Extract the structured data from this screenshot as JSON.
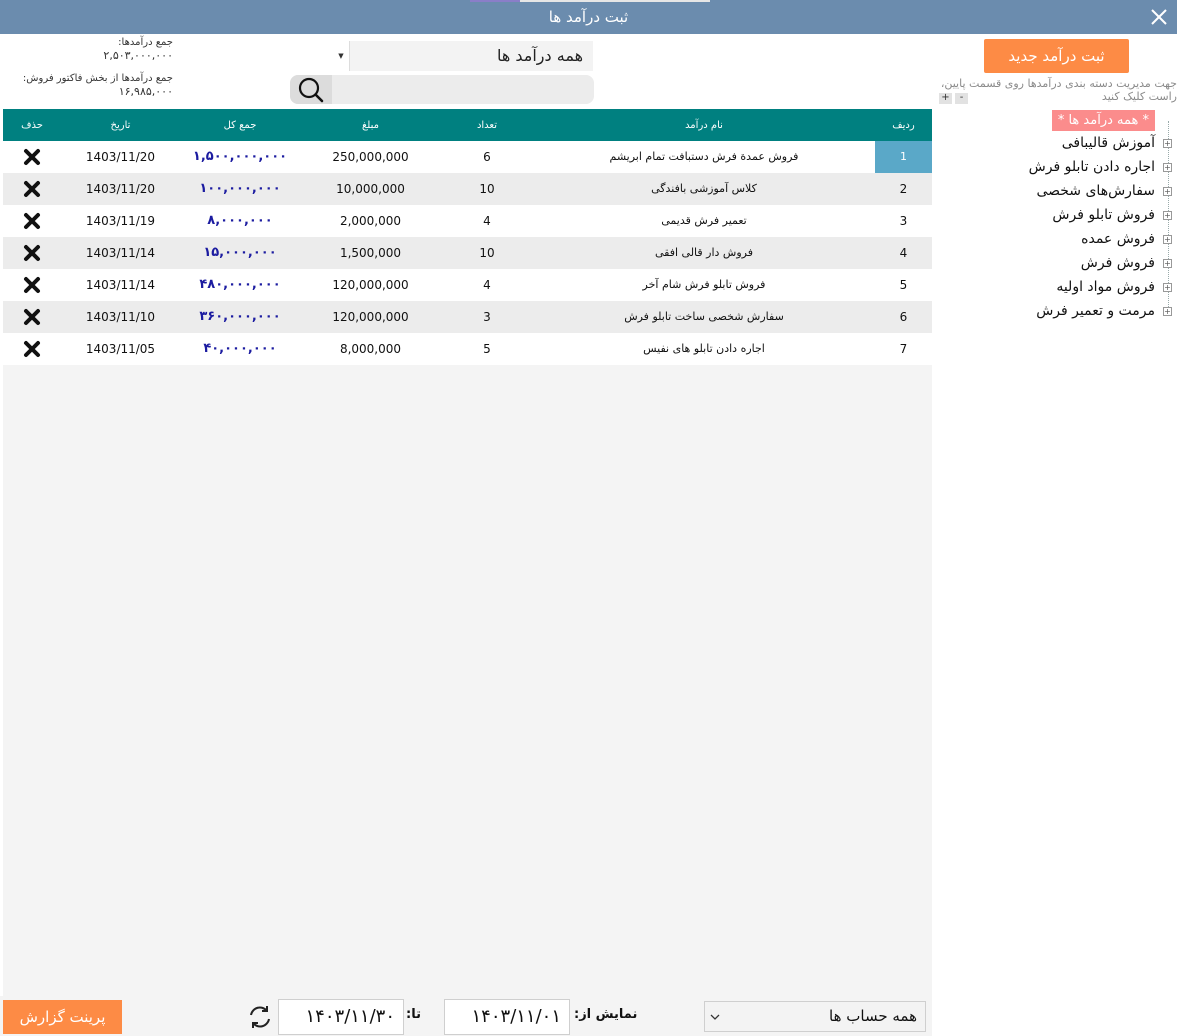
{
  "window": {
    "title": "ثبت درآمد ها"
  },
  "stats": {
    "total_label": "جمع درآمدها:",
    "total_value": "۲,۵۰۳,۰۰۰,۰۰۰",
    "sales_label": "جمع درآمدها از بخش فاکتور فروش:",
    "sales_value": "۱۶,۹۸۵,۰۰۰"
  },
  "filter": {
    "selected": "همه درآمد ها"
  },
  "search": {
    "value": ""
  },
  "buttons": {
    "new_income": "ثبت درآمد جدید",
    "print_report": "پرینت گزارش",
    "expand": "+",
    "collapse": "-"
  },
  "hint": "جهت مدیریت دسته بندی درآمدها روی قسمت پایین، راست کلیک کنید",
  "tree": {
    "root": "* همه درآمد ها *",
    "items": [
      "آموزش قالیبافی",
      "اجاره دادن تابلو فرش",
      "سفارش‌های شخصی",
      "فروش تابلو فرش",
      "فروش عمده",
      "فروش فرش",
      "فروش مواد اولیه",
      "مرمت و تعمیر فرش"
    ]
  },
  "table": {
    "columns": {
      "row": "ردیف",
      "name": "نام درآمد",
      "count": "تعداد",
      "amount": "مبلغ",
      "total": "جمع کل",
      "date": "تاریخ",
      "delete": "حذف"
    },
    "rows": [
      {
        "row": "1",
        "name": "فروش عمدة فرش دستبافت تمام ابریشم",
        "count": "6",
        "amount": "250,000,000",
        "total": "۱,۵۰۰,۰۰۰,۰۰۰",
        "date": "1403/11/20"
      },
      {
        "row": "2",
        "name": "کلاس آموزشی بافندگی",
        "count": "10",
        "amount": "10,000,000",
        "total": "۱۰۰,۰۰۰,۰۰۰",
        "date": "1403/11/20"
      },
      {
        "row": "3",
        "name": "تعمیر فرش قدیمی",
        "count": "4",
        "amount": "2,000,000",
        "total": "۸,۰۰۰,۰۰۰",
        "date": "1403/11/19"
      },
      {
        "row": "4",
        "name": "فروش دار قالی افقی",
        "count": "10",
        "amount": "1,500,000",
        "total": "۱۵,۰۰۰,۰۰۰",
        "date": "1403/11/14"
      },
      {
        "row": "5",
        "name": "فروش تابلو فرش شام آخر",
        "count": "4",
        "amount": "120,000,000",
        "total": "۴۸۰,۰۰۰,۰۰۰",
        "date": "1403/11/14"
      },
      {
        "row": "6",
        "name": "سفارش شخصی ساخت تابلو فرش",
        "count": "3",
        "amount": "120,000,000",
        "total": "۳۶۰,۰۰۰,۰۰۰",
        "date": "1403/11/10"
      },
      {
        "row": "7",
        "name": "اجاره دادن تابلو های نفیس",
        "count": "5",
        "amount": "8,000,000",
        "total": "۴۰,۰۰۰,۰۰۰",
        "date": "1403/11/05"
      }
    ]
  },
  "footer": {
    "from_label": "نمایش از:",
    "from_date": "۱۴۰۳/۱۱/۰۱",
    "to_label": "تا:",
    "to_date": "۱۴۰۳/۱۱/۳۰",
    "account_selected": "همه حساب ها"
  },
  "colors": {
    "titlebar": "#6b8cae",
    "header": "#008080",
    "accent_orange": "#fd8b45",
    "tree_root": "#fb8c8c",
    "selected_row": "#5aa8c8",
    "total_text": "#1b1ba0"
  }
}
